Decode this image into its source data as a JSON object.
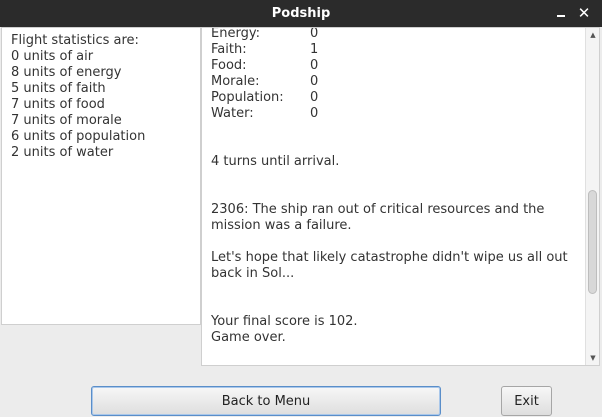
{
  "window": {
    "title": "Podship",
    "minimize_glyph": "—",
    "close_glyph": "✕"
  },
  "left_panel": {
    "heading": "Flight statistics are:",
    "lines": [
      "0 units of air",
      "8 units of energy",
      "5 units of faith",
      "7 units of food",
      "7 units of morale",
      "6 units of population",
      "2 units of water"
    ]
  },
  "log": {
    "stats": [
      {
        "name": "Energy:",
        "value": "0"
      },
      {
        "name": "Faith:",
        "value": "1"
      },
      {
        "name": "Food:",
        "value": "0"
      },
      {
        "name": "Morale:",
        "value": "0"
      },
      {
        "name": "Population:",
        "value": "0"
      },
      {
        "name": "Water:",
        "value": "0"
      }
    ],
    "turns_message": "4 turns until arrival.",
    "failure_line1": "2306: The ship ran out of critical resources and the",
    "failure_line2": "mission was a failure.",
    "hope_line1": "Let's hope that likely catastrophe didn't wipe us all out",
    "hope_line2": "back in Sol...",
    "score_line": "Your final score is 102.",
    "game_over": "Game over."
  },
  "scrollbar": {
    "up_glyph": "▲",
    "down_glyph": "▼",
    "position_fraction": 0.72
  },
  "buttons": {
    "back_to_menu": "Back to Menu",
    "exit": "Exit"
  }
}
